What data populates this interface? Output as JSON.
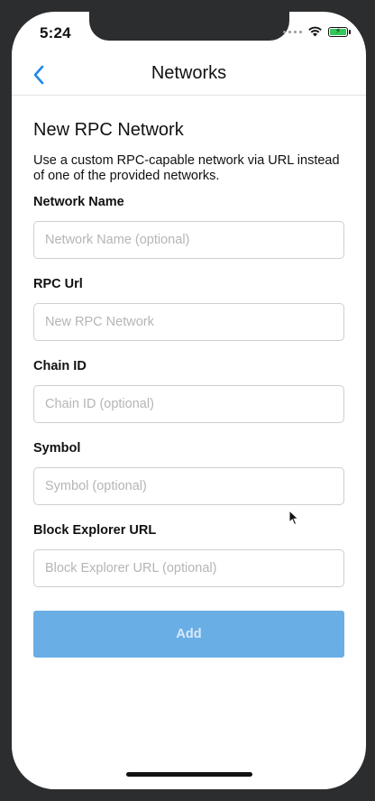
{
  "status_bar": {
    "time": "5:24"
  },
  "navbar": {
    "title": "Networks",
    "back_icon": "chevron-left-icon"
  },
  "form": {
    "title": "New RPC Network",
    "description": "Use a custom RPC-capable network via URL instead of one of the provided networks.",
    "fields": [
      {
        "label": "Network Name",
        "placeholder": "Network Name (optional)",
        "value": ""
      },
      {
        "label": "RPC Url",
        "placeholder": "New RPC Network",
        "value": ""
      },
      {
        "label": "Chain ID",
        "placeholder": "Chain ID (optional)",
        "value": ""
      },
      {
        "label": "Symbol",
        "placeholder": "Symbol (optional)",
        "value": ""
      },
      {
        "label": "Block Explorer URL",
        "placeholder": "Block Explorer URL (optional)",
        "value": ""
      }
    ],
    "add_label": "Add"
  },
  "colors": {
    "accent": "#1e88e5",
    "button_disabled": "#6aaee6",
    "battery": "#34c759"
  }
}
